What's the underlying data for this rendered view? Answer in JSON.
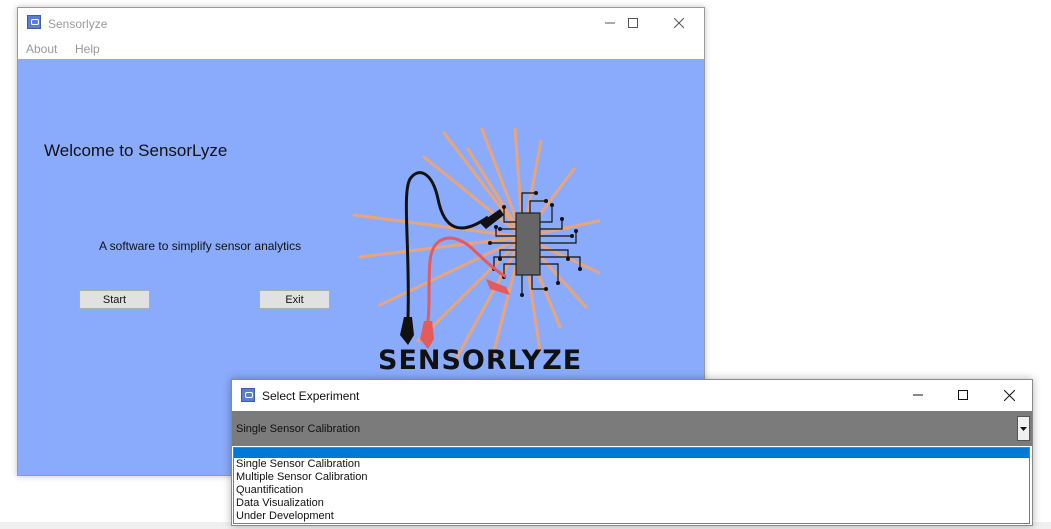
{
  "main_window": {
    "title": "Sensorlyze",
    "menu": [
      "About",
      "Help"
    ],
    "welcome": "Welcome to SensorLyze",
    "subtitle": "A software to simplify sensor analytics",
    "start_label": "Start",
    "exit_label": "Exit",
    "logo_text": "SENSORLYZE"
  },
  "dialog": {
    "title": "Select Experiment",
    "selected": "Single Sensor Calibration",
    "options": [
      "",
      "Single Sensor Calibration",
      "Multiple Sensor Calibration",
      "Quantification",
      "Data Visualization",
      "Under Development"
    ],
    "highlighted_index": 0
  },
  "colors": {
    "client_bg": "#8aabfb",
    "combo_bg": "#7b7b7b",
    "highlight": "#0078d7",
    "ray": "#e8a57c",
    "chip": "#666666",
    "red_lead": "#e55a5a"
  }
}
